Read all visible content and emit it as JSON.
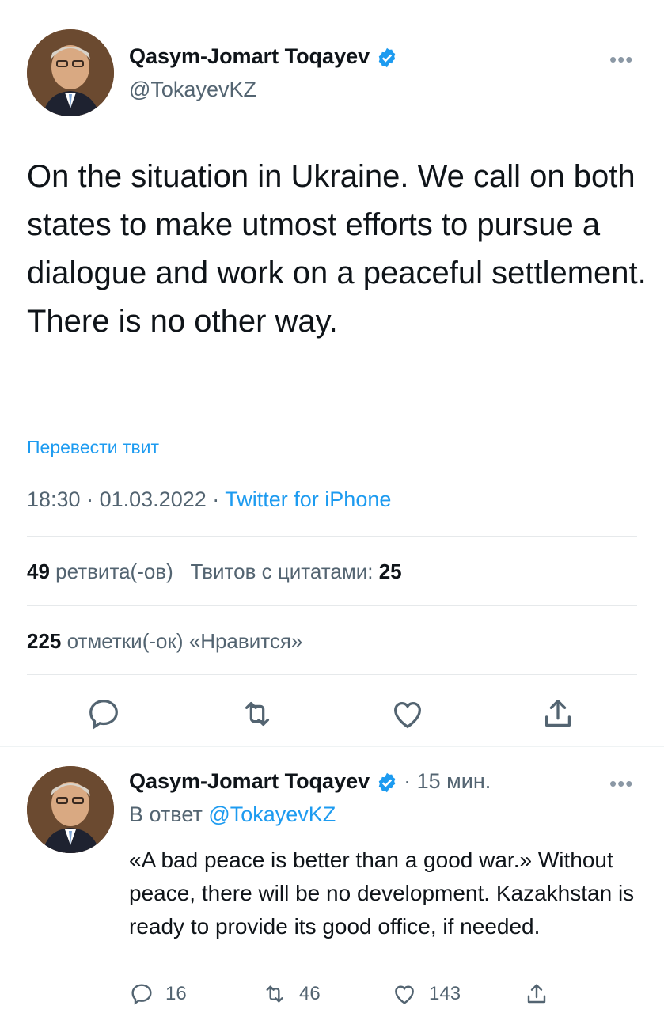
{
  "main_tweet": {
    "author_name": "Qasym-Jomart Toqayev",
    "author_handle": "@TokayevKZ",
    "more": "•••",
    "text": "On the situation in Ukraine. We call on both states to make utmost efforts to pursue a dialogue and work on a peaceful settlement. There is no other way.",
    "translate_label": "Перевести твит",
    "time": "18:30",
    "separator": "·",
    "date": "01.03.2022",
    "source": "Twitter for iPhone",
    "retweets_count": "49",
    "retweets_label": "ретвита(-ов)",
    "quotes_label": "Твитов с цитатами:",
    "quotes_count": "25",
    "likes_count": "225",
    "likes_label": "отметки(-ок) «Нравится»",
    "icons": [
      "reply-icon",
      "retweet-icon",
      "like-icon",
      "share-icon"
    ]
  },
  "reply_tweet": {
    "author_name": "Qasym-Jomart Toqayev",
    "time_ago": "· 15 мин.",
    "more": "•••",
    "reply_prefix": "В ответ",
    "reply_mention": "@TokayevKZ",
    "text": "«A bad peace is better than a good war.» Without peace, there will be no development. Kazakhstan is ready to provide its good office, if needed.",
    "replies": "16",
    "retweets": "46",
    "likes": "143"
  },
  "colors": {
    "accent": "#1d9bf0",
    "text": "#0f1419",
    "secondary": "#536471",
    "divider": "#e6e9eb"
  }
}
